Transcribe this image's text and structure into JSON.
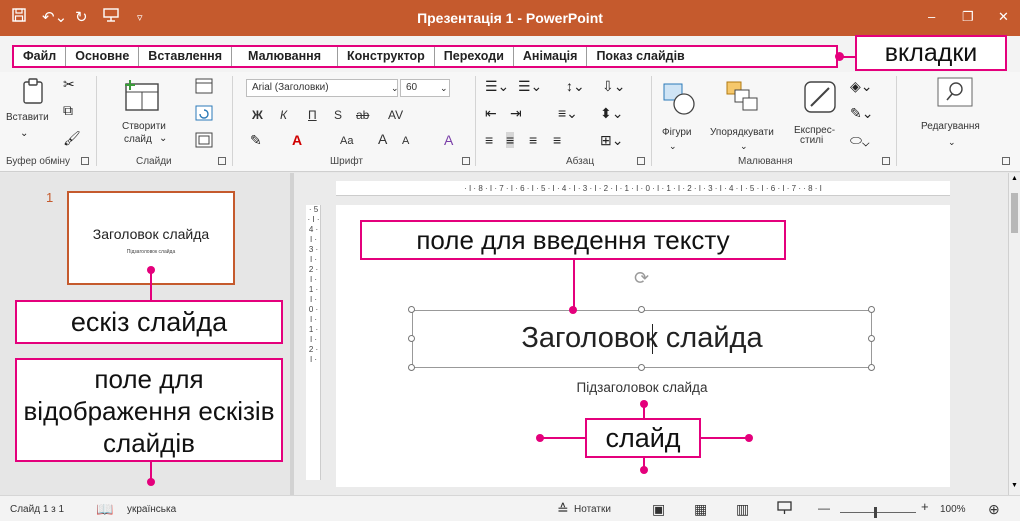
{
  "window": {
    "title": "Презентація 1  -  PowerPoint",
    "quick_access": {
      "save_icon": "floppy-disk",
      "undo_icon": "undo-arrow",
      "redo_icon": "redo-arrow",
      "present_icon": "present-from-start",
      "customize_icon": "customize-toolbar"
    },
    "controls": {
      "minimize": "–",
      "restore": "❐",
      "close": "✕"
    }
  },
  "tabs": [
    "Файл",
    "Основне",
    "Вставлення",
    "Малювання",
    "Конструктор",
    "Переходи",
    "Анімація",
    "Показ слайдів"
  ],
  "callouts": {
    "tabs": "вкладки",
    "text_field": "поле для введення тексту",
    "thumbnail": "ескіз слайда",
    "thumbnail_pane": "поле для відображення ескізів слайдів",
    "slide": "слайд"
  },
  "ribbon": {
    "clipboard": {
      "paste": "Вставити",
      "group": "Буфер обміну"
    },
    "slides": {
      "new_slide_line1": "Створити",
      "new_slide_line2": "слайд",
      "group": "Слайди"
    },
    "font": {
      "font_name": "Arial (Заголовки)",
      "font_size": "60",
      "bold": "Ж",
      "italic": "К",
      "underline": "П",
      "strike": "S",
      "strikethrough": "ab",
      "spacing": "AV",
      "case": "Aa",
      "grow": "A",
      "shrink": "A",
      "group": "Шрифт"
    },
    "paragraph": {
      "group": "Абзац"
    },
    "drawing": {
      "shapes": "Фігури",
      "arrange": "Упорядкувати",
      "quick_styles_line1": "Експрес-",
      "quick_styles_line2": "стилі",
      "group": "Малювання"
    },
    "editing": {
      "label": "Редагування"
    }
  },
  "thumbnails": [
    {
      "number": "1",
      "title": "Заголовок слайда",
      "subtitle": "Підзаголовок слайда"
    }
  ],
  "ruler": {
    "horizontal": "· I · 8 · I · 7 · I · 6 · I · 5 · I · 4 · I · 3 · I · 2 · I · 1 · I · 0 · I · 1 · I · 2 · I · 3 · I · 4 · I · 5 · I · 6 · I · 7 ·   · 8 · I",
    "vertical": "· 5 · I · 4 · I · 3 · I · 2 · I · 1 · I · 0 · I · 1 · I · 2 · I ·"
  },
  "slide": {
    "title": "Заголовок слайда",
    "subtitle": "Підзаголовок слайда"
  },
  "status": {
    "slide_counter": "Слайд 1 з 1",
    "language": "українська",
    "notes": "Нотатки",
    "zoom": "100%",
    "zoom_minus": "—",
    "zoom_plus": "+"
  },
  "colors": {
    "accent": "#c55a2d",
    "callout": "#e4007c"
  }
}
